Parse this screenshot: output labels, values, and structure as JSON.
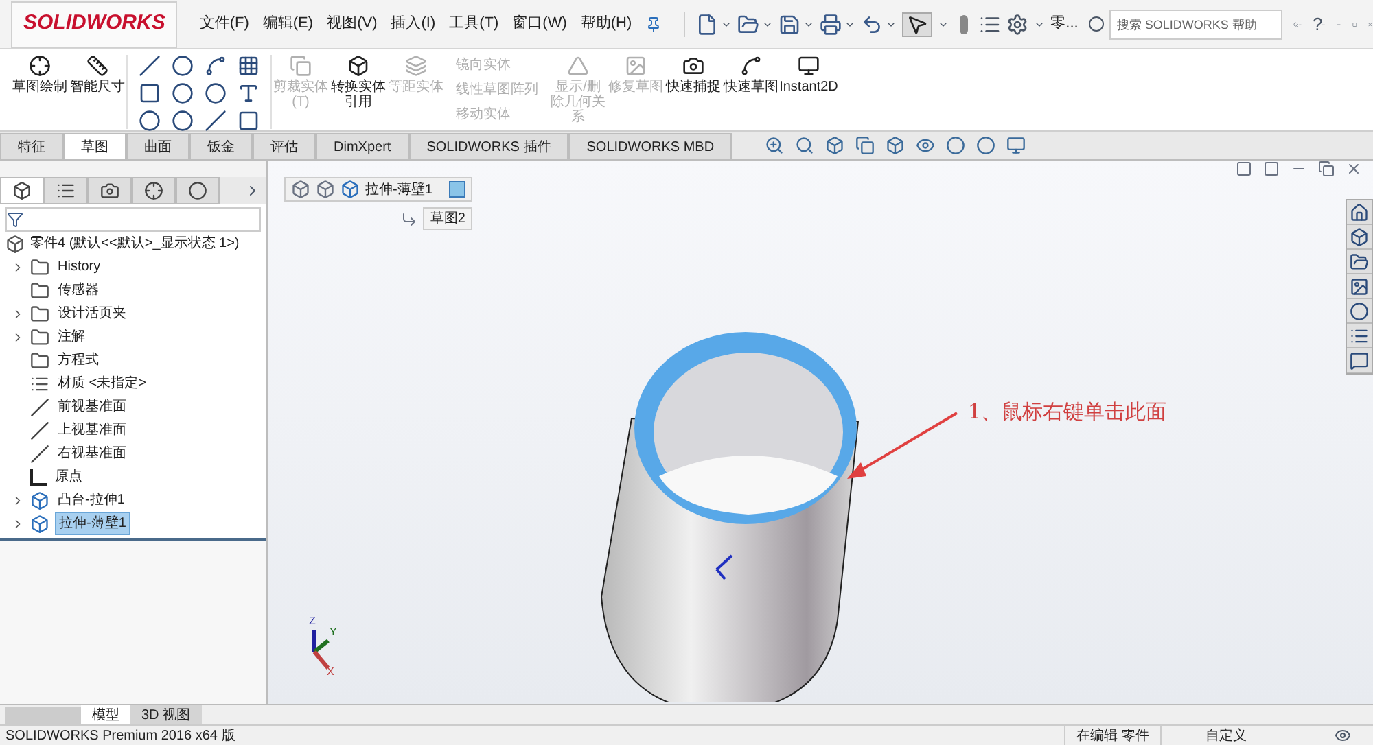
{
  "app": {
    "logo": "SOLIDWORKS"
  },
  "menu": [
    "文件(F)",
    "编辑(E)",
    "视图(V)",
    "插入(I)",
    "工具(T)",
    "窗口(W)",
    "帮助(H)"
  ],
  "toolbar": {
    "overflow": "零...",
    "search": {
      "placeholder": "搜索 SOLIDWORKS 帮助"
    },
    "help": "?"
  },
  "ribbon": {
    "commands": [
      {
        "label": "草图绘制",
        "kind": "large",
        "disabled": false
      },
      {
        "label": "智能尺寸",
        "kind": "large",
        "disabled": false
      },
      {
        "kind": "sketch-tools"
      },
      {
        "label": "剪裁实体(T)",
        "kind": "large",
        "disabled": true
      },
      {
        "label": "转换实体引用",
        "kind": "large",
        "disabled": false
      },
      {
        "label": "等距实体",
        "kind": "large",
        "disabled": true
      },
      {
        "kind": "small-list"
      },
      {
        "label": "显示/删除几何关系",
        "kind": "large",
        "disabled": true
      },
      {
        "label": "修复草图",
        "kind": "large",
        "disabled": true
      },
      {
        "label": "快速捕捉",
        "kind": "large",
        "disabled": false
      },
      {
        "label": "快速草图",
        "kind": "large",
        "disabled": false
      },
      {
        "label": "Instant2D",
        "kind": "large",
        "disabled": false
      }
    ],
    "small_commands": [
      {
        "label": "镜向实体",
        "disabled": true
      },
      {
        "label": "线性草图阵列",
        "disabled": true
      },
      {
        "label": "移动实体",
        "disabled": true
      }
    ]
  },
  "tabs": [
    {
      "label": "特征",
      "selected": false
    },
    {
      "label": "草图",
      "selected": true
    },
    {
      "label": "曲面",
      "selected": false
    },
    {
      "label": "钣金",
      "selected": false
    },
    {
      "label": "评估",
      "selected": false
    },
    {
      "label": "DimXpert",
      "selected": false
    },
    {
      "label": "SOLIDWORKS 插件",
      "selected": false
    },
    {
      "label": "SOLIDWORKS MBD",
      "selected": false
    }
  ],
  "panel_tabs": [
    {
      "selected": true
    },
    {
      "selected": false
    },
    {
      "selected": false
    },
    {
      "selected": false
    },
    {
      "selected": false
    }
  ],
  "feature_tree": {
    "root": "零件4  (默认<<默认>_显示状态 1>)",
    "items": [
      {
        "label": "History",
        "kind": "folder",
        "expandable": true,
        "selected": false
      },
      {
        "label": "传感器",
        "kind": "folder",
        "expandable": false,
        "selected": false
      },
      {
        "label": "设计活页夹",
        "kind": "folder",
        "expandable": true,
        "selected": false
      },
      {
        "label": "注解",
        "kind": "folder",
        "expandable": true,
        "selected": false
      },
      {
        "label": "方程式",
        "kind": "folder",
        "expandable": false,
        "selected": false
      },
      {
        "label": "材质 <未指定>",
        "kind": "material",
        "expandable": false,
        "selected": false
      },
      {
        "label": "前视基准面",
        "kind": "plane",
        "expandable": false,
        "selected": false
      },
      {
        "label": "上视基准面",
        "kind": "plane",
        "expandable": false,
        "selected": false
      },
      {
        "label": "右视基准面",
        "kind": "plane",
        "expandable": false,
        "selected": false
      },
      {
        "label": "原点",
        "kind": "origin",
        "expandable": false,
        "selected": false
      },
      {
        "label": "凸台-拉伸1",
        "kind": "feature",
        "expandable": true,
        "selected": false
      },
      {
        "label": "拉伸-薄壁1",
        "kind": "feature",
        "expandable": true,
        "selected": true
      }
    ]
  },
  "viewport": {
    "breadcrumb": "拉伸-薄壁1",
    "sub_item": "草图2",
    "annotation": "1、鼠标右键单击此面",
    "axes": [
      "Z",
      "Y",
      "X"
    ]
  },
  "bottom_tabs": [
    {
      "label": "模型",
      "selected": true
    },
    {
      "label": "3D 视图",
      "selected": false
    }
  ],
  "status_bar": {
    "version": "SOLIDWORKS Premium 2016 x64 版",
    "mode": "在编辑 零件",
    "units": "自定义"
  }
}
